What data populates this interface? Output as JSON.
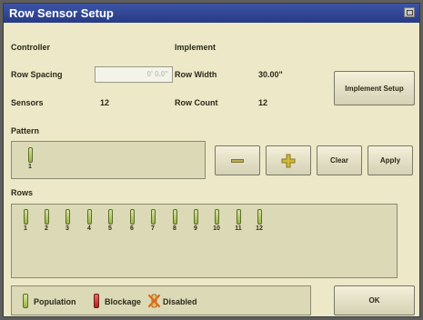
{
  "window": {
    "title": "Row Sensor Setup"
  },
  "controller": {
    "heading": "Controller",
    "row_spacing_label": "Row Spacing",
    "row_spacing_value": "0' 0.0\"",
    "sensors_label": "Sensors",
    "sensors_value": "12"
  },
  "implement": {
    "heading": "Implement",
    "row_width_label": "Row Width",
    "row_width_value": "30.00\"",
    "row_count_label": "Row Count",
    "row_count_value": "12",
    "setup_button": "Implement Setup"
  },
  "pattern": {
    "label": "Pattern",
    "sensors": [
      "1"
    ],
    "clear_button": "Clear",
    "apply_button": "Apply"
  },
  "rows": {
    "label": "Rows",
    "sensors": [
      "1",
      "2",
      "3",
      "4",
      "5",
      "6",
      "7",
      "8",
      "9",
      "10",
      "11",
      "12"
    ]
  },
  "legend": {
    "population": "Population",
    "blockage": "Blockage",
    "disabled": "Disabled"
  },
  "ok_button": "OK",
  "icons": {
    "minus": "minus-icon",
    "plus": "plus-icon",
    "window_button": "window-restore-icon"
  },
  "colors": {
    "title_bar": "#2f4594",
    "background": "#ece8c8",
    "population": "#b5cf63",
    "blockage": "#d63a2e",
    "disabled": "#e88a2a"
  }
}
